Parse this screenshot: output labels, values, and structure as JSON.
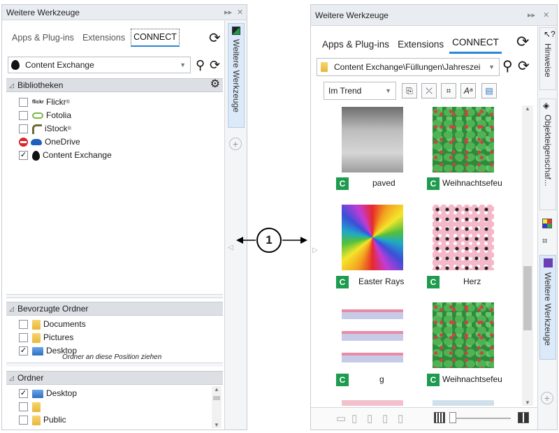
{
  "left": {
    "title": "Weitere Werkzeuge",
    "tabs": [
      "Apps & Plug-ins",
      "Extensions",
      "CONNECT"
    ],
    "combo_value": "Content Exchange",
    "sections": {
      "libraries": {
        "title": "Bibliotheken",
        "items": [
          {
            "label": "Flickr",
            "sup": "®",
            "checked": false,
            "icon": "flickr-icon"
          },
          {
            "label": "Fotolia",
            "sup": "",
            "checked": false,
            "icon": "fotolia-icon"
          },
          {
            "label": "iStock",
            "sup": "®",
            "checked": false,
            "icon": "istock-icon"
          },
          {
            "label": "OneDrive",
            "sup": "",
            "checked": null,
            "icon": "onedrive-icon"
          },
          {
            "label": "Content Exchange",
            "sup": "",
            "checked": true,
            "icon": "content-exchange-icon"
          }
        ]
      },
      "favorites": {
        "title": "Bevorzugte Ordner",
        "items": [
          {
            "label": "Documents",
            "checked": false
          },
          {
            "label": "Pictures",
            "checked": false
          },
          {
            "label": "Desktop",
            "checked": true
          }
        ],
        "drop_hint": "Ordner an diese Position ziehen"
      },
      "folders": {
        "title": "Ordner",
        "items": [
          {
            "label": "Desktop",
            "checked": true
          },
          {
            "label": "",
            "checked": false
          },
          {
            "label": "Public",
            "checked": false
          }
        ]
      }
    },
    "side_tab": "Weitere Werkzeuge",
    "flickr_logo_text": "flickr"
  },
  "callout": {
    "number": "1"
  },
  "right": {
    "title": "Weitere Werkzeuge",
    "tabs": [
      "Apps & Plug-ins",
      "Extensions",
      "CONNECT"
    ],
    "path_value": "Content Exchange\\Füllungen\\Jahreszei",
    "filter_value": "Im Trend",
    "tiles": [
      {
        "label": "paved",
        "pattern": "paved"
      },
      {
        "label": "Weihnachtsefeu",
        "pattern": "ivy"
      },
      {
        "label": "Easter Rays",
        "pattern": "rays"
      },
      {
        "label": "Herz",
        "pattern": "hearts"
      },
      {
        "label": "g",
        "pattern": "flowers"
      },
      {
        "label": "Weihnachtsefeu",
        "pattern": "ivy"
      }
    ],
    "side_tabs": [
      "Hinweise",
      "Objekteigenschaf...",
      "Weitere Werkzeuge"
    ],
    "badge_letter": "C"
  }
}
